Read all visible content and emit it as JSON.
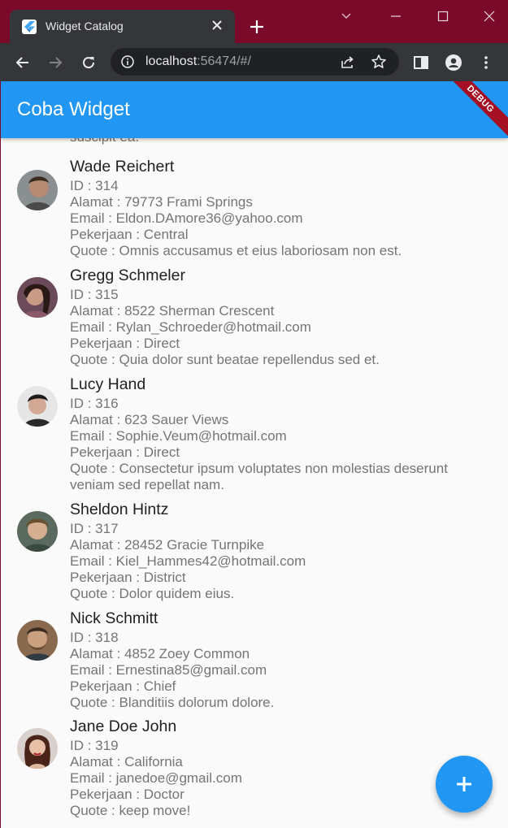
{
  "browser": {
    "tab_title": "Widget Catalog",
    "url_host": "localhost",
    "url_rest": ":56474/#/"
  },
  "app": {
    "title": "Coba Widget",
    "debug_banner": "DEBUG",
    "cut_text": "suscipit ea."
  },
  "people": [
    {
      "name": "Wade Reichert",
      "id": "ID : 314",
      "alamat": "Alamat : 79773 Frami Springs",
      "email": "Email : Eldon.DAmore36@yahoo.com",
      "pekerjaan": "Pekerjaan : Central",
      "quote": "Quote : Omnis accusamus et eius laboriosam non est."
    },
    {
      "name": "Gregg Schmeler",
      "id": "ID : 315",
      "alamat": "Alamat : 8522 Sherman Crescent",
      "email": "Email : Rylan_Schroeder@hotmail.com",
      "pekerjaan": "Pekerjaan : Direct",
      "quote": "Quote : Quia dolor sunt beatae repellendus sed et."
    },
    {
      "name": "Lucy Hand",
      "id": "ID : 316",
      "alamat": "Alamat : 623 Sauer Views",
      "email": "Email : Sophie.Veum@hotmail.com",
      "pekerjaan": "Pekerjaan : Direct",
      "quote": "Quote : Consectetur ipsum voluptates non molestias deserunt veniam sed repellat nam."
    },
    {
      "name": "Sheldon Hintz",
      "id": "ID : 317",
      "alamat": "Alamat : 28452 Gracie Turnpike",
      "email": "Email : Kiel_Hammes42@hotmail.com",
      "pekerjaan": "Pekerjaan : District",
      "quote": "Quote : Dolor quidem eius."
    },
    {
      "name": "Nick Schmitt",
      "id": "ID : 318",
      "alamat": "Alamat : 4852 Zoey Common",
      "email": "Email : Ernestina85@gmail.com",
      "pekerjaan": "Pekerjaan : Chief",
      "quote": "Quote : Blanditiis dolorum dolore."
    },
    {
      "name": "Jane Doe John",
      "id": "ID : 319",
      "alamat": "Alamat : California",
      "email": "Email : janedoe@gmail.com",
      "pekerjaan": "Pekerjaan : Doctor",
      "quote": "Quote : keep move!"
    }
  ],
  "colors": {
    "accent": "#2196f3",
    "frame": "#7b0a2a",
    "toolbar": "#35363a"
  },
  "icons": [
    "flutter-icon",
    "close-icon",
    "plus-icon",
    "minimize-icon",
    "maximize-icon",
    "back-icon",
    "forward-icon",
    "reload-icon",
    "info-icon",
    "share-icon",
    "star-icon",
    "sidepanel-icon",
    "profile-icon",
    "menu-dots-icon",
    "add-icon"
  ]
}
